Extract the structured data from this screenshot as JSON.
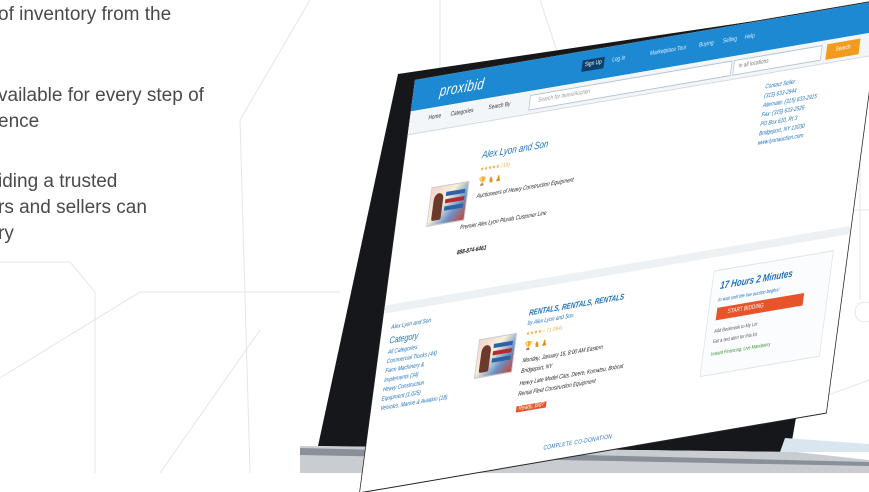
{
  "marketing": {
    "bullet1_line1": "of inventory from the",
    "bullet2_line1": "vailable for every step of",
    "bullet2_line2": "ence",
    "bullet3_line1": "iding a trusted",
    "bullet3_line2": "rs and sellers can",
    "bullet3_line3": "ry"
  },
  "site": {
    "logo": "proxibid",
    "sign_in": "Sign Up",
    "top_links": [
      "Log In",
      "Marketplace Tour",
      "Buying",
      "Selling",
      "Help"
    ],
    "nav": [
      "Home",
      "Categories",
      "Search By"
    ],
    "search_placeholder": "Search for Items/Auction",
    "location_placeholder": "in all locations",
    "search_button": "Search"
  },
  "seller": {
    "name": "Alex Lyon and Son",
    "stars": "★★★★★ (13)",
    "tagline": "Auctioneers of Heavy Construction Equipment",
    "sub_tagline": "Premier Alex Lyon Plurals Customer Line",
    "phone": "888-874-6461",
    "contact_lines": [
      "Contact Seller",
      "(315) 633-2944",
      "Alternate: (315) 633-2915",
      "Fax: (315) 633-2526",
      "PO Box 610, Rt 3",
      "Bridgeport, NY 13030",
      "www.lyonauction.com"
    ]
  },
  "categories": {
    "back": "Alex Lyon and Son",
    "heading": "Category",
    "items": [
      "All Categories",
      "Commercial Trucks (44)",
      "Farm Machinery &",
      "Implements (34)",
      "Heavy Construction",
      "Equipment (1,025)",
      "Vehicles, Marine & Aviation (18)"
    ]
  },
  "listing": {
    "title": "RENTALS, RENTALS, RENTALS",
    "by": "by Alex Lyon and Son",
    "stars": "★★★★☆ (1,284)",
    "date": "Monday, January 16, 8:00 AM Eastern",
    "location": "Bridgeport, NY",
    "desc1": "Heavy Late Model Cats, Deere, Komatsu, Bobcat",
    "desc2": "Rental Fleet Construction Equipment",
    "ready": "Ready, Bid?"
  },
  "timer": {
    "time_left": "17 Hours 2 Minutes",
    "note": "to wait until the live auction begins!",
    "watch_button": "START BIDDING",
    "line1": "Add Bookmark to My Lot",
    "line2": "Get a text alert for this lot",
    "line3": "Instant Financing: Live Mandatory"
  },
  "complete": "COMPLETE CO-DONATION"
}
